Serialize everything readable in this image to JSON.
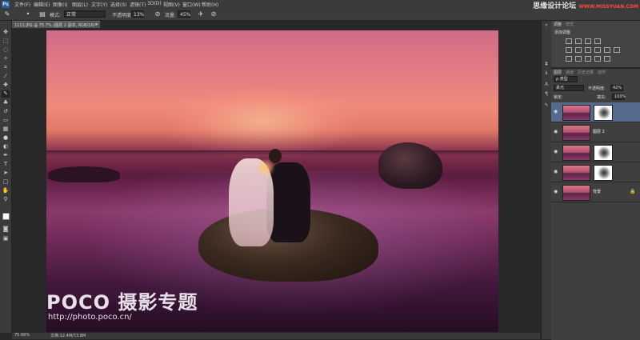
{
  "menubar": {
    "logo": "Ps",
    "items": [
      "文件(F)",
      "编辑(E)",
      "图像(I)",
      "图层(L)",
      "文字(Y)",
      "选择(S)",
      "滤镜(T)",
      "3D(D)",
      "视图(V)",
      "窗口(W)",
      "帮助(H)"
    ],
    "watermark": "思缘设计论坛",
    "watermark_url": "WWW.MISSYUAN.COM"
  },
  "options": {
    "mode_label": "模式:",
    "mode_value": "正常",
    "opacity_label": "不透明度:",
    "opacity_value": "13%",
    "flow_label": "流量:",
    "flow_value": "45%"
  },
  "document": {
    "tab_title": "1111.JPG @ 75.7% (图层 2 副本, RGB/16) *",
    "close": "×"
  },
  "status": {
    "zoom": "75.66%",
    "doc_info": "文档:12.4M/73.8M"
  },
  "photo_watermark": {
    "brand": "POCO 摄影专题",
    "url": "http://photo.poco.cn/"
  },
  "adjustments": {
    "tabs": [
      "调整",
      "样式"
    ],
    "title": "添加调整"
  },
  "layers": {
    "tabs": [
      "图层",
      "通道",
      "历史记录",
      "动作"
    ],
    "kind_label": "ρ 类型",
    "blend_mode": "柔光",
    "opacity_label": "不透明度:",
    "opacity_value": "42%",
    "lock_label": "锁定:",
    "fill_label": "填充:",
    "fill_value": "100%",
    "items": [
      {
        "name": "",
        "selected": true,
        "has_mask": true
      },
      {
        "name": "图层 2",
        "selected": false,
        "has_mask": false
      },
      {
        "name": "",
        "selected": false,
        "has_mask": true
      },
      {
        "name": "",
        "selected": false,
        "has_mask": true
      },
      {
        "name": "背景",
        "selected": false,
        "has_mask": false
      }
    ]
  }
}
